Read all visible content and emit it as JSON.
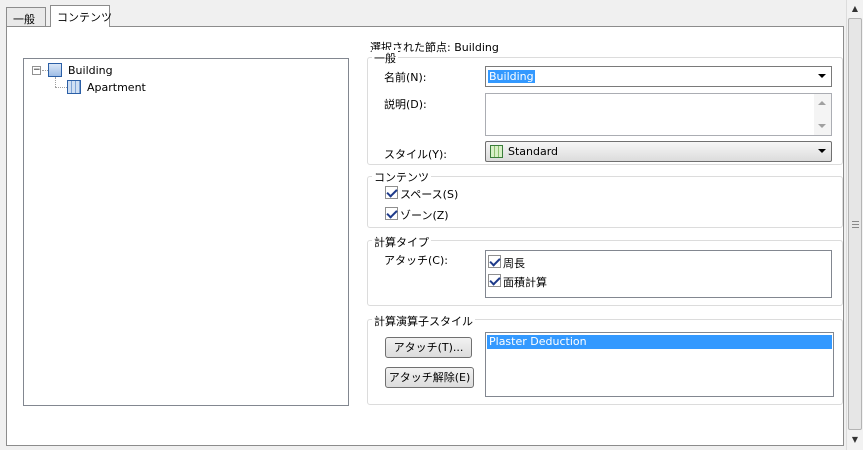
{
  "tabs": [
    {
      "label": "一般",
      "active": false
    },
    {
      "label": "コンテンツ",
      "active": true
    }
  ],
  "tree": {
    "root": {
      "label": "Building",
      "expanded": true,
      "expander": "−",
      "icon": "building-icon"
    },
    "children": [
      {
        "label": "Apartment",
        "icon": "apartment-icon"
      }
    ]
  },
  "selected_node": {
    "label": "選択された節点:",
    "value": "Building"
  },
  "general": {
    "title": "一般",
    "name_label": "名前(N):",
    "name_value": "Building",
    "description_label": "説明(D):",
    "description_value": "",
    "style_label": "スタイル(Y):",
    "style_value": "Standard"
  },
  "contents": {
    "title": "コンテンツ",
    "space_label": "スペース(S)",
    "space_checked": true,
    "zone_label": "ゾーン(Z)",
    "zone_checked": true
  },
  "calc_type": {
    "title": "計算タイプ",
    "attach_label": "アタッチ(C):",
    "items": [
      {
        "label": "周長",
        "checked": true
      },
      {
        "label": "面積計算",
        "checked": true
      }
    ]
  },
  "modifier_style": {
    "title": "計算演算子スタイル",
    "attach_button": "アタッチ(T)...",
    "detach_button": "アタッチ解除(E)",
    "items": [
      "Plaster Deduction"
    ],
    "selected_index": 0
  },
  "colors": {
    "selection": "#3399ff",
    "accent_blue": "#2b5fa6"
  }
}
